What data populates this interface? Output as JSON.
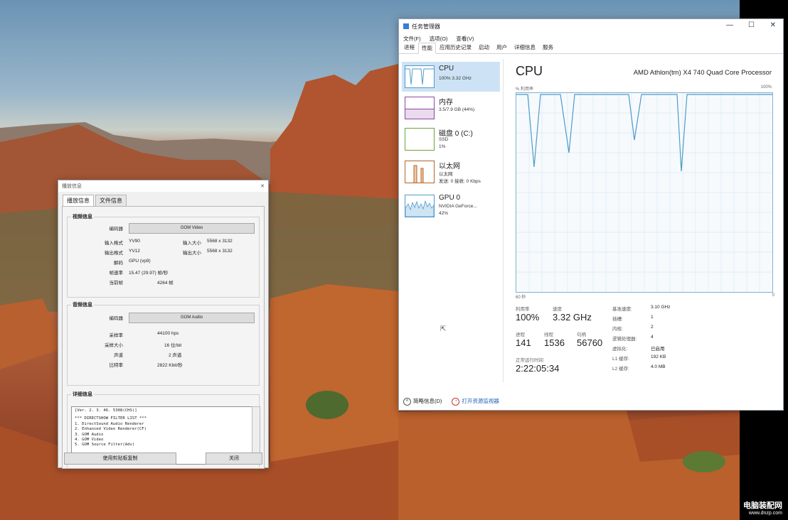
{
  "media_info": {
    "title": "播放信息",
    "tabs": [
      "播放信息",
      "文件信息"
    ],
    "video_group": "视频信息",
    "video_codec_label": "编码器",
    "video_codec": "GOM Video",
    "input_format_label": "输入格式",
    "input_format": "YV90",
    "input_size_label": "输入大小",
    "input_size": "5568 x 3132",
    "output_format_label": "输出格式",
    "output_format": "YV12",
    "output_size_label": "输出大小",
    "output_size": "5568 x 3132",
    "decode_label": "解码",
    "decode": "GPU (vp9)",
    "framerate_label": "帧速率",
    "framerate": "15.47 (29.97) 帧/秒",
    "current_frame_label": "当前帧",
    "current_frame": "4264 帧",
    "audio_group": "音频信息",
    "audio_codec_label": "编码器",
    "audio_codec": "GOM Audio",
    "samplerate_label": "采样率",
    "samplerate": "44100 hps",
    "samplesize_label": "采样大小",
    "samplesize": "16 位/bit",
    "channels_label": "声道",
    "channels": "2 声道",
    "bitrate_label": "比特率",
    "bitrate": "2822 Kbit/秒",
    "detail_group": "详细信息",
    "log_lines": [
      "[Ver. 2. 3. 46. 5308(CHS)]",
      "",
      "*** DIRECTSHOW FILTER LIST ***",
      "1. DirectSound Audio Renderer",
      "2. Enhanced Video Renderer(CF)",
      "3. GOM Audio",
      "4. GOM Video",
      "5. GOM Source Filter(Adv)"
    ],
    "copy_button": "使用剪贴板复制",
    "close_button": "关闭"
  },
  "task_manager": {
    "title": "任务管理器",
    "menu": [
      "文件(F)",
      "选项(O)",
      "查看(V)"
    ],
    "tabs": [
      "进程",
      "性能",
      "应用历史记录",
      "启动",
      "用户",
      "详细信息",
      "服务"
    ],
    "sidebar": [
      {
        "name": "CPU",
        "sub1": "100% 3.32 GHz",
        "sub2": ""
      },
      {
        "name": "内存",
        "sub1": "3.5/7.9 GB (44%)",
        "sub2": ""
      },
      {
        "name": "磁盘 0 (C:)",
        "sub1": "SSD",
        "sub2": "1%"
      },
      {
        "name": "以太网",
        "sub1": "以太网",
        "sub2": "发送: 0 接收: 0 Kbps"
      },
      {
        "name": "GPU 0",
        "sub1": "NVIDIA GeForce...",
        "sub2": "42%"
      }
    ],
    "main_title": "CPU",
    "processor": "AMD Athlon(tm) X4 740 Quad Core Processor",
    "graph_label": "% 利用率",
    "graph_max": "100%",
    "graph_time": "60 秒",
    "graph_min": "0",
    "stats": {
      "util_label": "利用率",
      "util": "100%",
      "speed_label": "速度",
      "speed": "3.32 GHz",
      "proc_label": "进程",
      "proc": "141",
      "thread_label": "线程",
      "thread": "1536",
      "handle_label": "句柄",
      "handle": "56760",
      "uptime_label": "正常运行时间",
      "uptime": "2:22:05:34"
    },
    "specs": [
      {
        "k": "基准速度:",
        "v": "3.10 GHz"
      },
      {
        "k": "插槽:",
        "v": "1"
      },
      {
        "k": "内核:",
        "v": "2"
      },
      {
        "k": "逻辑处理器:",
        "v": "4"
      },
      {
        "k": "虚拟化:",
        "v": "已启用"
      },
      {
        "k": "L1 缓存:",
        "v": "192 KB"
      },
      {
        "k": "L2 缓存:",
        "v": "4.0 MB"
      }
    ],
    "bottom_brief": "简略信息(D)",
    "bottom_monitor": "打开资源监视器",
    "accent": "#1d5fb8"
  },
  "watermark": {
    "line1": "电脑装配网",
    "line2": "www.dnzp.com"
  }
}
